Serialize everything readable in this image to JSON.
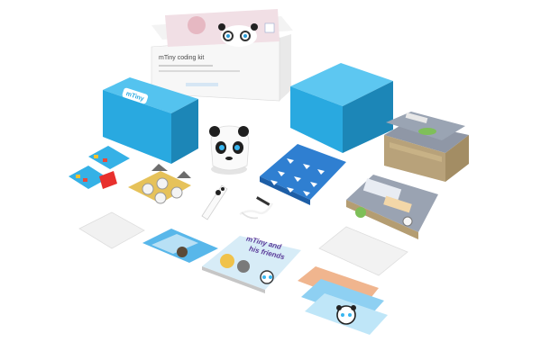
{
  "product_box": {
    "title": "mTiny coding kit",
    "brand_lid": "mTiny"
  },
  "story_book": {
    "title_line1": "mTiny and",
    "title_line2": "his friends"
  },
  "colors": {
    "box_blue": "#29a9e0",
    "box_blue_dark": "#1c86b7",
    "map_gray": "#8f97a6",
    "card_blue": "#2f7fd1",
    "background": "#ffffff"
  }
}
